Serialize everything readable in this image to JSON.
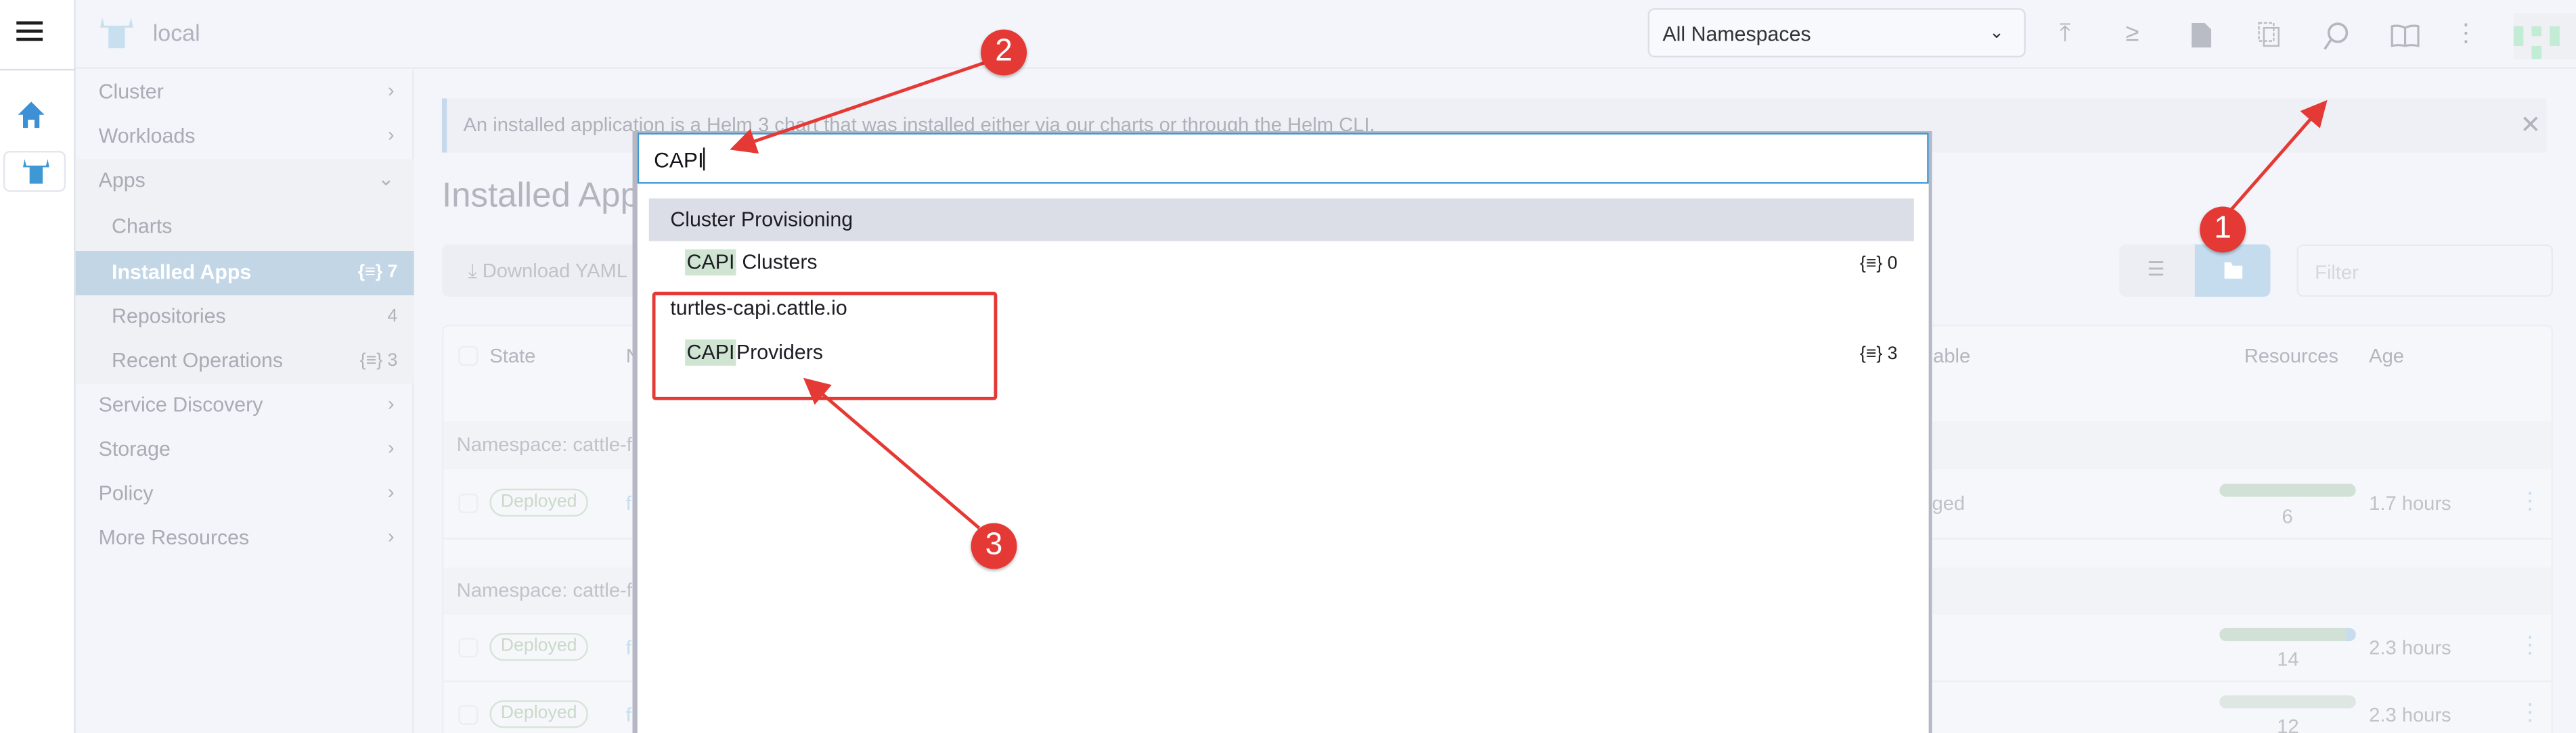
{
  "header": {
    "cluster_name": "local",
    "namespace_select": "All Namespaces",
    "icons": [
      "upload-icon",
      "terminal-icon",
      "file-icon",
      "copy-icon",
      "search-icon",
      "book-icon",
      "more-vertical-icon"
    ]
  },
  "sidebar": {
    "items": [
      {
        "label": "Cluster"
      },
      {
        "label": "Workloads"
      },
      {
        "label": "Apps"
      },
      {
        "label": "Charts"
      },
      {
        "label": "Installed Apps",
        "count": "7"
      },
      {
        "label": "Repositories",
        "count": "4"
      },
      {
        "label": "Recent Operations",
        "count": "3"
      },
      {
        "label": "Service Discovery"
      },
      {
        "label": "Storage"
      },
      {
        "label": "Policy"
      },
      {
        "label": "More Resources"
      }
    ]
  },
  "banner": {
    "text": "An installed application is a Helm 3 chart that was installed either via our charts or through the Helm CLI.",
    "close": "✕"
  },
  "page": {
    "title": "Installed Apps",
    "download_label": "Download YAML",
    "filter_placeholder": "Filter"
  },
  "table": {
    "headers": {
      "state": "State",
      "name": "N",
      "upgradable": "dable",
      "resources": "Resources",
      "age": "Age"
    },
    "groups": [
      {
        "label": "Namespace: cattle-fle",
        "rows": [
          {
            "state": "Deployed",
            "name": "f",
            "upgradable": "ged",
            "resources": "6",
            "ready_fraction": 1.0,
            "age": "1.7 hours"
          }
        ]
      },
      {
        "label": "Namespace: cattle-fle",
        "rows": [
          {
            "state": "Deployed",
            "name": "f",
            "upgradable": "",
            "resources": "14",
            "ready_fraction": 0.93,
            "age": "2.3 hours"
          },
          {
            "state": "Deployed",
            "name": "f",
            "upgradable": "",
            "resources": "12",
            "ready_fraction": 1.0,
            "age": "2.3 hours"
          }
        ]
      }
    ]
  },
  "search": {
    "query": "CAPI",
    "groups": [
      {
        "title": "Cluster Provisioning",
        "items": [
          {
            "match": "CAPI",
            "rest": " Clusters",
            "count": "0"
          }
        ]
      },
      {
        "title": "turtles-capi.cattle.io",
        "items": [
          {
            "match": "CAPI",
            "rest": "Providers",
            "count": "3"
          }
        ]
      }
    ]
  },
  "annotations": {
    "markers": [
      "1",
      "2",
      "3"
    ],
    "color": "#e53935"
  },
  "colors": {
    "accent": "#3d98d3",
    "active_nav": "#c2d6e6",
    "highlight": "#d0e4d2"
  }
}
